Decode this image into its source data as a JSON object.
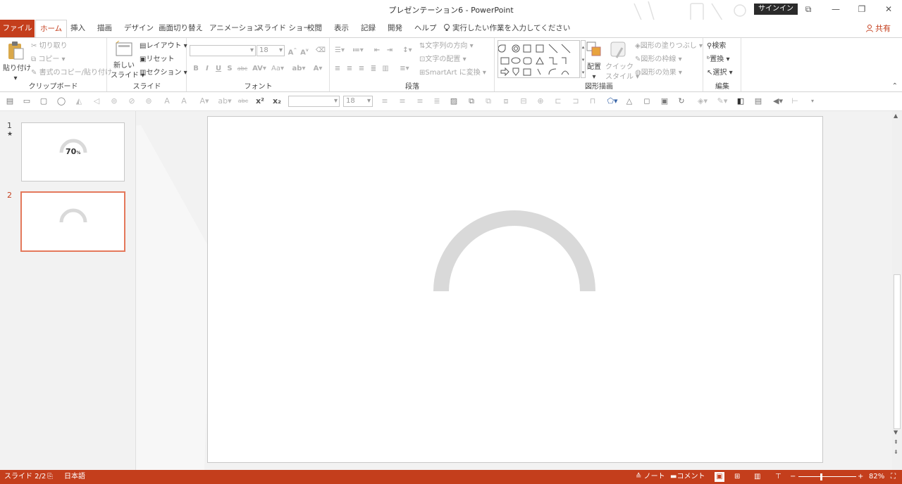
{
  "window": {
    "title": "プレゼンテーション6  -  PowerPoint",
    "signin_label": "サインイン",
    "restore_glyph": "⧉",
    "minimize_glyph": "—",
    "maximize_glyph": "❐",
    "close_glyph": "✕"
  },
  "tabs": [
    {
      "label": "ファイル"
    },
    {
      "label": "ホーム"
    },
    {
      "label": "挿入"
    },
    {
      "label": "描画"
    },
    {
      "label": "デザイン"
    },
    {
      "label": "画面切り替え"
    },
    {
      "label": "アニメーション"
    },
    {
      "label": "スライド ショー"
    },
    {
      "label": "校閲"
    },
    {
      "label": "表示"
    },
    {
      "label": "記録"
    },
    {
      "label": "開発"
    },
    {
      "label": "ヘルプ"
    }
  ],
  "tellme": "実行したい作業を入力してください",
  "share_label": "共有",
  "ribbon": {
    "clipboard": {
      "paste": "貼り付け",
      "cut": "切り取り",
      "copy": "コピー",
      "format_painter": "書式のコピー/貼り付け",
      "label": "クリップボード"
    },
    "slides": {
      "new_slide_line1": "新しい",
      "new_slide_line2": "スライド",
      "layout": "レイアウト",
      "reset": "リセット",
      "section": "セクション",
      "label": "スライド"
    },
    "font": {
      "size": "18",
      "label": "フォント"
    },
    "paragraph": {
      "text_direction": "文字列の方向",
      "align_text": "文字の配置",
      "smartart": "SmartArt に変換",
      "label": "段落"
    },
    "drawing": {
      "arrange": "配置",
      "quick_style_line1": "クイック",
      "quick_style_line2": "スタイル",
      "shape_fill": "図形の塗りつぶし",
      "shape_outline": "図形の枠線",
      "shape_effects": "図形の効果",
      "label": "図形描画"
    },
    "editing": {
      "find": "検索",
      "replace": "置換",
      "select": "選択",
      "label": "編集"
    }
  },
  "quick_toolbar": {
    "font_size": "18"
  },
  "slides": [
    {
      "number": "1",
      "has_animation": true,
      "animation_mark": "★",
      "label_text": "70",
      "label_suffix": "%",
      "selected": false
    },
    {
      "number": "2",
      "has_animation": false,
      "label_text": "",
      "selected": true
    }
  ],
  "status": {
    "slide_info": "スライド 2/2",
    "language": "日本語",
    "notes": "ノート",
    "comments": "コメント",
    "zoom": "82%"
  },
  "colors": {
    "accent": "#c43e1c",
    "arc_gray": "#d9d9d9",
    "thumb_selected": "#e4785b"
  }
}
